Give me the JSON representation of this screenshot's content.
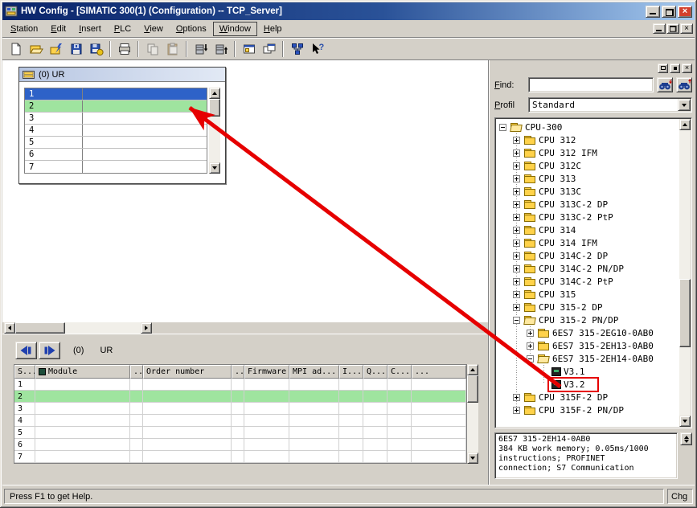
{
  "window": {
    "title": "HW Config - [SIMATIC 300(1) (Configuration) -- TCP_Server]"
  },
  "menu": {
    "items": [
      "Station",
      "Edit",
      "Insert",
      "PLC",
      "View",
      "Options",
      "Window",
      "Help"
    ],
    "highlighted": "Window"
  },
  "toolbar": {
    "buttons": [
      "new",
      "open",
      "open-online",
      "save",
      "save-compile",
      "print",
      "copy",
      "paste",
      "download",
      "upload",
      "catalog-toggle",
      "station-windows",
      "network-config",
      "help"
    ]
  },
  "station_window": {
    "title": "(0) UR",
    "rows": [
      "1",
      "2",
      "3",
      "4",
      "5",
      "6",
      "7"
    ],
    "selected_row": "1",
    "highlighted_row": "2"
  },
  "detail_panel": {
    "rack_number": "(0)",
    "rack_name": "UR",
    "columns": [
      "S...",
      "Module",
      "...",
      "Order number",
      "...",
      "Firmware",
      "MPI ad...",
      "I...",
      "Q...",
      "C...",
      "..."
    ],
    "rows": [
      "1",
      "2",
      "3",
      "4",
      "5",
      "6",
      "7"
    ],
    "highlighted_row": "2"
  },
  "catalog": {
    "find_label": "Find:",
    "find_value": "",
    "profile_label": "Profil",
    "profile_value": "Standard",
    "tree": [
      {
        "label": "CPU-300",
        "level": 0,
        "expander": "minus",
        "icon": "folder-open"
      },
      {
        "label": "CPU 312",
        "level": 1,
        "expander": "plus",
        "icon": "folder"
      },
      {
        "label": "CPU 312 IFM",
        "level": 1,
        "expander": "plus",
        "icon": "folder"
      },
      {
        "label": "CPU 312C",
        "level": 1,
        "expander": "plus",
        "icon": "folder"
      },
      {
        "label": "CPU 313",
        "level": 1,
        "expander": "plus",
        "icon": "folder"
      },
      {
        "label": "CPU 313C",
        "level": 1,
        "expander": "plus",
        "icon": "folder"
      },
      {
        "label": "CPU 313C-2 DP",
        "level": 1,
        "expander": "plus",
        "icon": "folder"
      },
      {
        "label": "CPU 313C-2 PtP",
        "level": 1,
        "expander": "plus",
        "icon": "folder"
      },
      {
        "label": "CPU 314",
        "level": 1,
        "expander": "plus",
        "icon": "folder"
      },
      {
        "label": "CPU 314 IFM",
        "level": 1,
        "expander": "plus",
        "icon": "folder"
      },
      {
        "label": "CPU 314C-2 DP",
        "level": 1,
        "expander": "plus",
        "icon": "folder"
      },
      {
        "label": "CPU 314C-2 PN/DP",
        "level": 1,
        "expander": "plus",
        "icon": "folder"
      },
      {
        "label": "CPU 314C-2 PtP",
        "level": 1,
        "expander": "plus",
        "icon": "folder"
      },
      {
        "label": "CPU 315",
        "level": 1,
        "expander": "plus",
        "icon": "folder"
      },
      {
        "label": "CPU 315-2 DP",
        "level": 1,
        "expander": "plus",
        "icon": "folder"
      },
      {
        "label": "CPU 315-2 PN/DP",
        "level": 1,
        "expander": "minus",
        "icon": "folder-open"
      },
      {
        "label": "6ES7 315-2EG10-0AB0",
        "level": 2,
        "expander": "plus",
        "icon": "folder"
      },
      {
        "label": "6ES7 315-2EH13-0AB0",
        "level": 2,
        "expander": "plus",
        "icon": "folder"
      },
      {
        "label": "6ES7 315-2EH14-0AB0",
        "level": 2,
        "expander": "minus",
        "icon": "folder-open"
      },
      {
        "label": "V3.1",
        "level": 3,
        "expander": null,
        "icon": "module"
      },
      {
        "label": "V3.2",
        "level": 3,
        "expander": null,
        "icon": "module",
        "annotated": true
      },
      {
        "label": "CPU 315F-2 DP",
        "level": 1,
        "expander": "plus",
        "icon": "folder"
      },
      {
        "label": "CPU 315F-2 PN/DP",
        "level": 1,
        "expander": "plus",
        "icon": "folder"
      }
    ],
    "info_title": "6ES7 315-2EH14-0AB0",
    "info_lines": [
      "384 KB work memory; 0.05ms/1000",
      "instructions; PROFINET",
      "connection; S7 Communication"
    ]
  },
  "statusbar": {
    "help_text": "Press F1 to get Help.",
    "right_label": "Chg"
  },
  "colors": {
    "selection_blue": "#2e62c8",
    "highlight_green": "#9fe49f",
    "annotation_red": "#e60000",
    "titlebar_dark": "#0a246a",
    "titlebar_light": "#a6caf0",
    "window_gray": "#d4d0c8"
  }
}
